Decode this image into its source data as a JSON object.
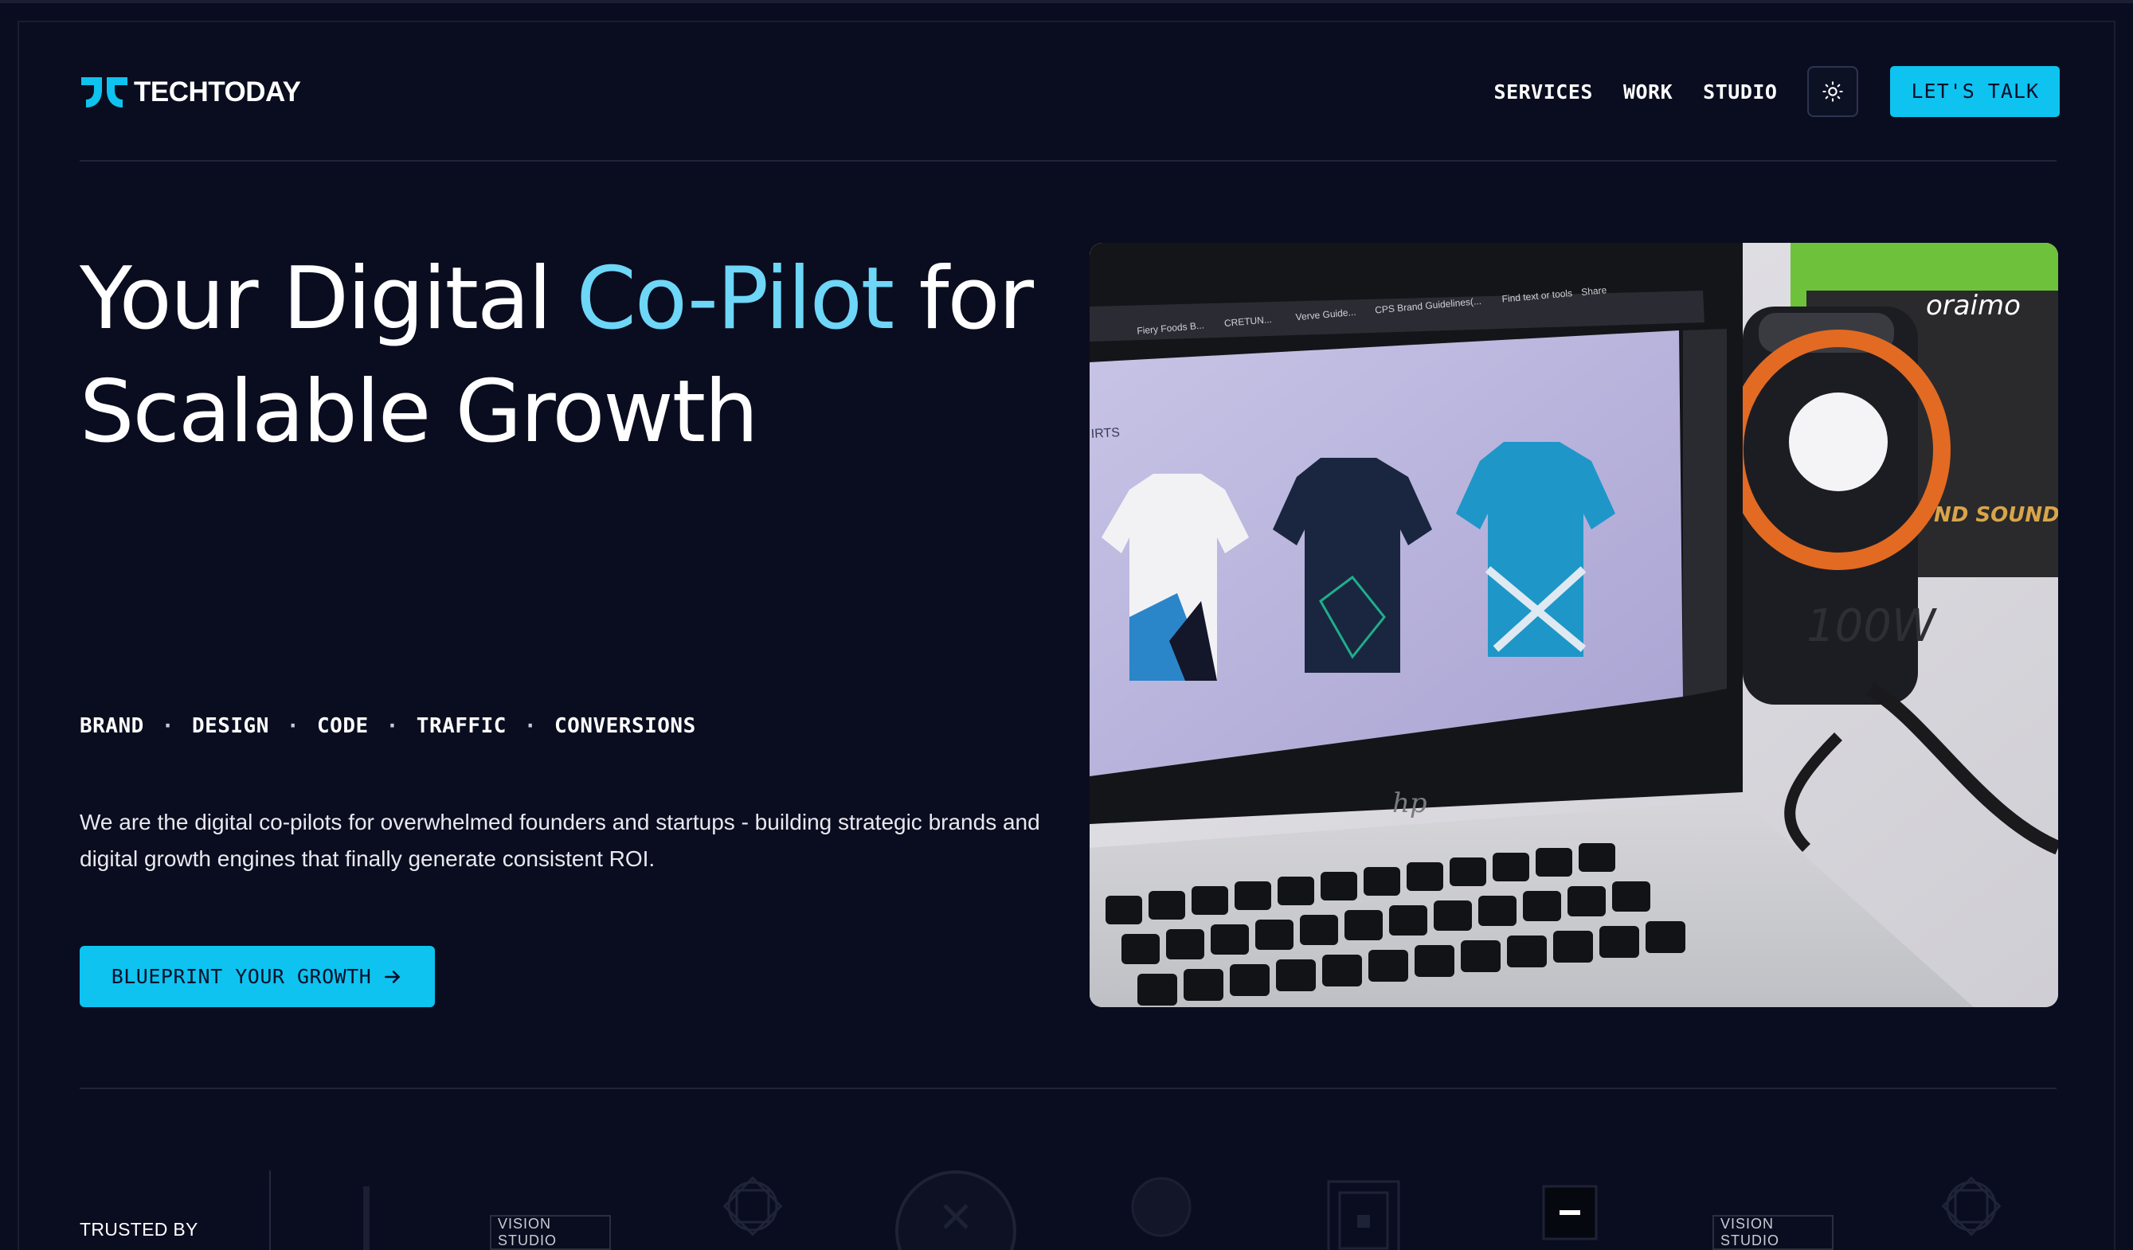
{
  "brand": {
    "name": "TECHTODAY",
    "logo_icon": "techtoday-logo-icon"
  },
  "nav": {
    "links": [
      "SERVICES",
      "WORK",
      "STUDIO"
    ],
    "theme_toggle_icon": "sun-icon",
    "cta_label": "LET'S TALK"
  },
  "hero": {
    "title_part1": "Your Digital ",
    "title_accent": "Co-Pilot",
    "title_part2": " for Scalable Growth",
    "tags": [
      "BRAND",
      "DESIGN",
      "CODE",
      "TRAFFIC",
      "CONVERSIONS"
    ],
    "tag_separator": "·",
    "description": "We are the digital co-pilots for overwhelmed founders and startups - building strategic brands and digital growth engines that finally generate consistent ROI.",
    "cta_label": "BLUEPRINT YOUR GROWTH",
    "cta_icon": "arrow-right-icon",
    "image_description": "laptop-with-shirt-mockups"
  },
  "screen_text": {
    "tab1": "Fiery Foods B...",
    "tab2": "CRETUN...",
    "tab3": "Verve Guide...",
    "tab4": "CPS Brand Guidelines(...",
    "search_hint": "Find text or tools",
    "share": "Share",
    "page_label": "IRTS",
    "laptop_brand": "hp",
    "speaker_brand": "oraimo",
    "speaker_box": "ND SOUND",
    "speaker_watt": "100W"
  },
  "trusted": {
    "label": "TRUSTED BY",
    "logos": [
      "VISION STUDIO",
      "VISION STUDIO"
    ]
  },
  "colors": {
    "accent": "#0ec3f0",
    "accent_text": "#6ed6f7",
    "background": "#0a0d1f"
  }
}
